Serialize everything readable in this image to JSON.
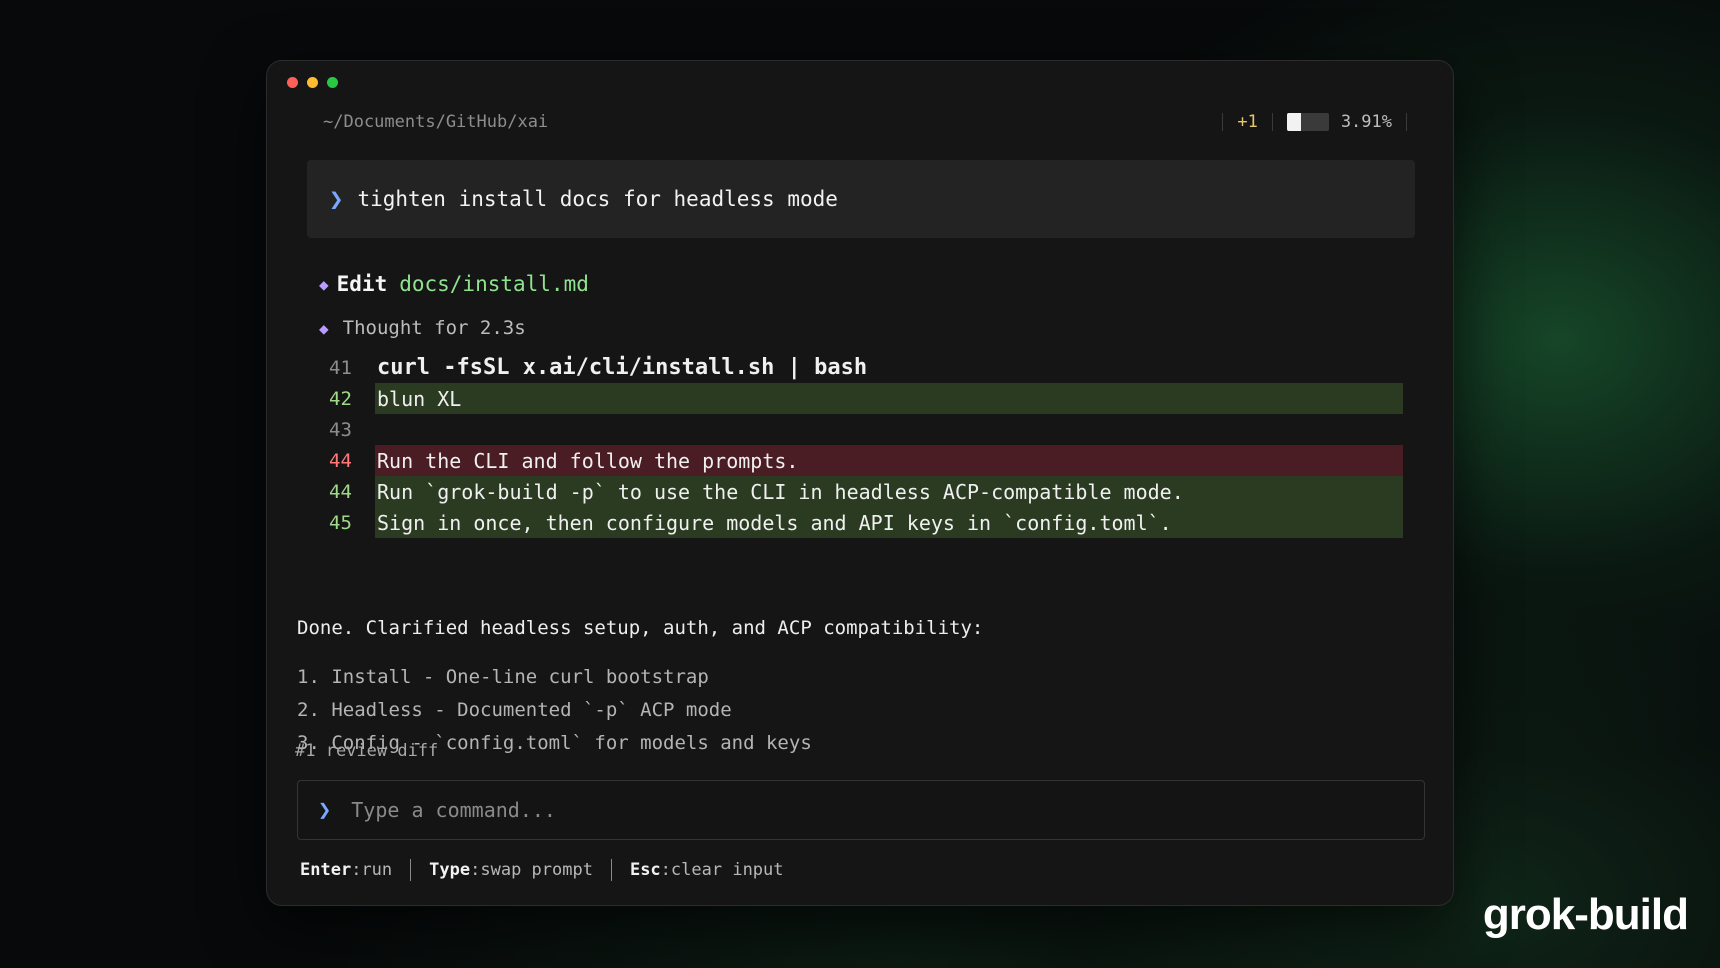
{
  "window": {
    "path": "~/Documents/GitHub/xai",
    "status": {
      "count": "+1",
      "usage_text": "3.91%",
      "usage_fraction": 0.0391
    }
  },
  "prompt": {
    "icon": "chevron-right-icon",
    "text": "tighten install docs for headless mode"
  },
  "steps": {
    "edit_label": "Edit",
    "edit_file": "docs/install.md",
    "thought": "Thought for 2.3s",
    "icon": "diamond-icon"
  },
  "diff": [
    {
      "ln": "41",
      "code": "curl -fsSL x.ai/cli/install.sh | bash",
      "kind": "plain"
    },
    {
      "ln": "42",
      "code": "blun XL",
      "kind": "added"
    },
    {
      "ln": "43",
      "code": "",
      "kind": "plain"
    },
    {
      "ln": "44",
      "code": "Run the CLI and follow the prompts.",
      "kind": "removed"
    },
    {
      "ln": "44",
      "code": "Run `grok-build -p` to use the CLI in headless ACP-compatible mode.",
      "kind": "added"
    },
    {
      "ln": "45",
      "code": "Sign in once, then configure models and API keys in `config.toml`.",
      "kind": "added"
    }
  ],
  "summary": "Done. Clarified headless setup, auth, and ACP compatibility:",
  "list": [
    "1. Install - One-line curl bootstrap",
    "2. Headless - Documented `-p` ACP mode",
    "3. Config - `config.toml` for models and keys"
  ],
  "todo": "#1 review diff",
  "input": {
    "placeholder": "Type a command...",
    "value": ""
  },
  "hints": [
    {
      "key": "Enter",
      "desc": "run"
    },
    {
      "key": "Type",
      "desc": "swap prompt"
    },
    {
      "key": "Esc",
      "desc": "clear input"
    }
  ],
  "brand": "grok-build",
  "colors": {
    "accent": "#7aa7ff",
    "added_bg": "#2a3b22",
    "removed_bg": "#4a1c24",
    "file_green": "#8fe38f",
    "diamond": "#b99cff"
  }
}
